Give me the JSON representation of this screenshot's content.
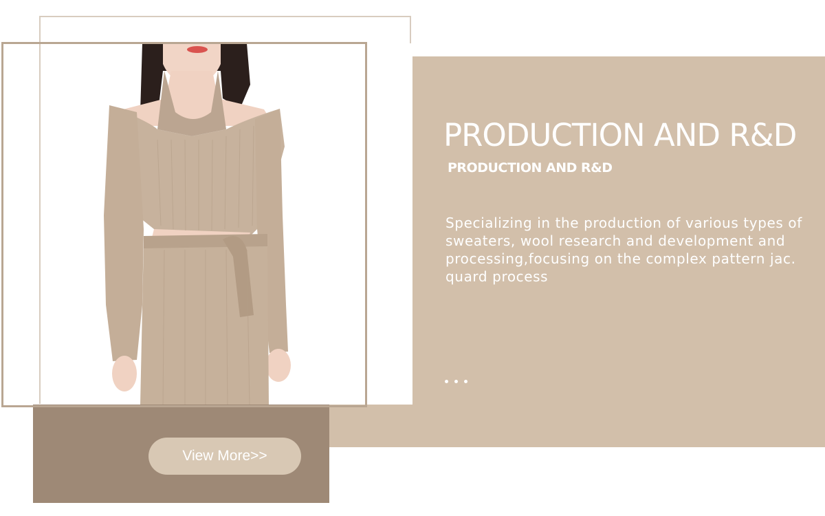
{
  "section": {
    "title": "PRODUCTION AND R&D",
    "subtitle": "PRODUCTION AND R&D",
    "description": "Specializing in the production of various types of sweaters, wool research and development and processing,focusing on the complex pattern jac. quard process"
  },
  "button": {
    "label": "View More>>"
  },
  "carousel": {
    "dot_count": 3
  },
  "colors": {
    "panel": "#d2bfaa",
    "brown_block": "#9e8976",
    "frame": "#b9a692",
    "button": "#d8c8b4",
    "garment": "#c7b29d"
  },
  "image": {
    "subject": "model-in-beige-ribbed-knit-set"
  }
}
